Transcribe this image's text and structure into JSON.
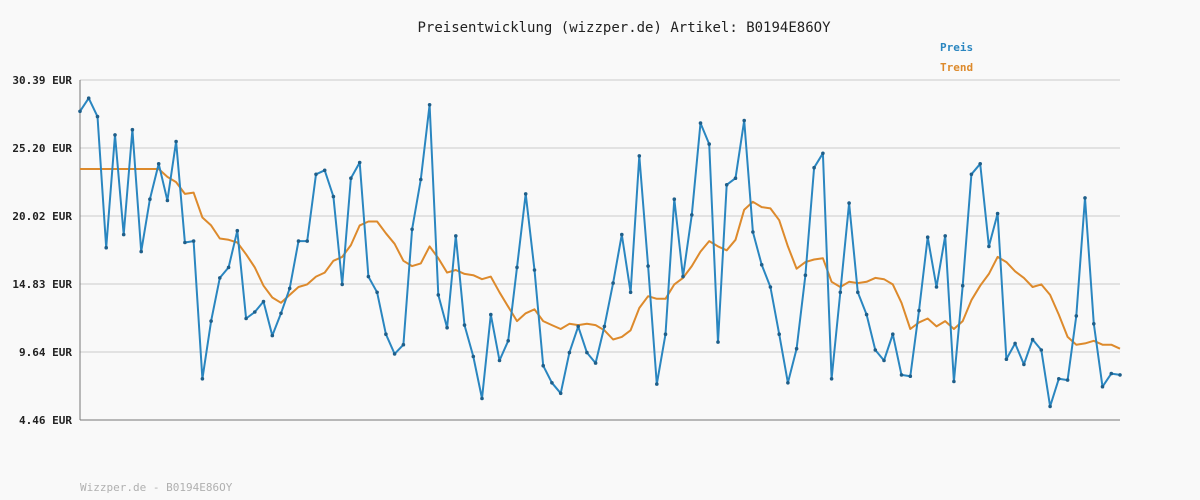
{
  "chart_data": {
    "type": "line",
    "title": "Preisentwicklung (wizzper.de) Artikel: B0194E86OY",
    "xlabel": "",
    "ylabel": "",
    "y_ticks": [
      "30.39 EUR",
      "25.20 EUR",
      "20.02 EUR",
      "14.83 EUR",
      "9.64 EUR",
      "4.46 EUR"
    ],
    "ylim": [
      4.46,
      30.39
    ],
    "grid": true,
    "legend_position": "top-right",
    "footer": "Wizzper.de - B0194E86OY",
    "colors": {
      "Preis": "#2a86c0",
      "Trend": "#dd8a2c"
    },
    "series": [
      {
        "name": "Preis",
        "values": [
          28.0,
          29.0,
          27.6,
          17.6,
          26.2,
          18.6,
          26.6,
          17.3,
          21.3,
          24.0,
          21.2,
          25.7,
          18.0,
          18.1,
          7.6,
          12.0,
          15.3,
          16.1,
          18.9,
          12.2,
          12.7,
          13.5,
          10.9,
          12.6,
          14.5,
          18.1,
          18.1,
          23.2,
          23.5,
          21.5,
          14.8,
          22.9,
          24.1,
          15.4,
          14.2,
          11.0,
          9.5,
          10.2,
          19.0,
          22.8,
          28.5,
          14.0,
          11.5,
          18.5,
          11.7,
          9.3,
          6.1,
          12.5,
          9.0,
          10.5,
          16.1,
          21.7,
          15.9,
          8.6,
          7.3,
          6.5,
          9.6,
          11.6,
          9.6,
          8.8,
          11.6,
          14.9,
          18.6,
          14.2,
          24.6,
          16.2,
          7.2,
          11.0,
          21.3,
          15.4,
          20.1,
          27.1,
          25.5,
          10.4,
          22.4,
          22.9,
          27.3,
          18.8,
          16.3,
          14.6,
          11.0,
          7.3,
          9.9,
          15.5,
          23.7,
          24.8,
          7.6,
          14.2,
          21.0,
          14.2,
          12.5,
          9.8,
          9.0,
          11.0,
          7.9,
          7.8,
          12.8,
          18.4,
          14.6,
          18.5,
          7.4,
          14.7,
          23.2,
          24.0,
          17.7,
          20.2,
          9.1,
          10.3,
          8.7,
          10.6,
          9.8,
          5.5,
          7.6,
          7.5,
          12.4,
          21.4,
          11.8,
          7.0,
          8.0,
          7.9
        ]
      },
      {
        "name": "Trend",
        "values": [
          23.6,
          23.6,
          23.6,
          23.6,
          23.6,
          23.6,
          23.6,
          23.6,
          23.6,
          23.6,
          23.0,
          22.6,
          21.7,
          21.8,
          19.9,
          19.3,
          18.3,
          18.2,
          18.0,
          17.1,
          16.1,
          14.7,
          13.8,
          13.4,
          14.0,
          14.6,
          14.8,
          15.4,
          15.7,
          16.6,
          16.9,
          17.8,
          19.3,
          19.6,
          19.6,
          18.7,
          17.9,
          16.6,
          16.2,
          16.4,
          17.7,
          16.8,
          15.7,
          15.9,
          15.6,
          15.5,
          15.2,
          15.4,
          14.2,
          13.1,
          12.0,
          12.6,
          12.9,
          12.0,
          11.7,
          11.4,
          11.8,
          11.7,
          11.8,
          11.7,
          11.3,
          10.6,
          10.8,
          11.3,
          13.0,
          13.9,
          13.7,
          13.7,
          14.8,
          15.3,
          16.2,
          17.3,
          18.1,
          17.7,
          17.4,
          18.2,
          20.5,
          21.1,
          20.7,
          20.6,
          19.7,
          17.7,
          16.0,
          16.5,
          16.7,
          16.8,
          15.0,
          14.6,
          15.0,
          14.9,
          15.0,
          15.3,
          15.2,
          14.8,
          13.4,
          11.4,
          11.9,
          12.2,
          11.6,
          12.0,
          11.4,
          12.0,
          13.6,
          14.7,
          15.6,
          16.9,
          16.5,
          15.8,
          15.3,
          14.6,
          14.8,
          14.0,
          12.5,
          10.8,
          10.2,
          10.3,
          10.5,
          10.2,
          10.2,
          9.9
        ]
      }
    ]
  }
}
